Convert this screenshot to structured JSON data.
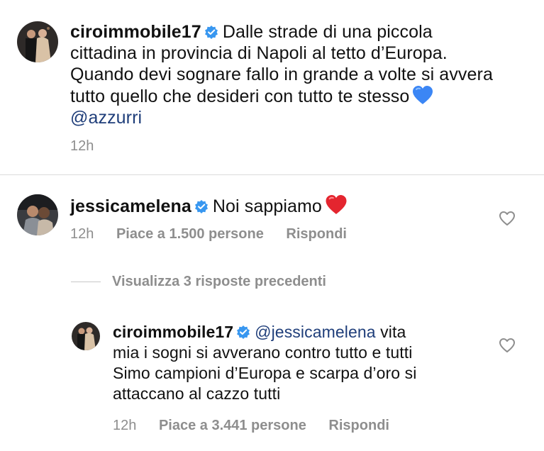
{
  "comment1": {
    "username": "ciroimmobile17",
    "lines": [
      "Dalle strade di una piccola",
      "cittadina in provincia di Napoli al tetto d’Europa.",
      "Quando devi sognare fallo in grande a volte si avvera",
      "tutto quello che desideri con tutto te stesso"
    ],
    "mention": "@azzurri",
    "time": "12h"
  },
  "comment2": {
    "username": "jessicamelena",
    "text": "Noi sappiamo",
    "time": "12h",
    "likes": "Piace a 1.500 persone",
    "reply_label": "Rispondi"
  },
  "view_replies": "Visualizza 3 risposte precedenti",
  "reply1": {
    "username": "ciroimmobile17",
    "mention": "@jessicamelena",
    "first_line_rest": "vita",
    "lines": [
      "mia i sogni si avverano contro tutto e tutti",
      "Simo campioni d’Europa e scarpa d’oro si",
      "attaccano al cazzo tutti"
    ],
    "time": "12h",
    "likes": "Piace a 3.441 persone",
    "reply_label": "Rispondi"
  },
  "colors": {
    "text": "#111111",
    "meta": "#8e8e8e",
    "mention": "#1f3e7a",
    "verified": "#3897f0",
    "blue_heart": "#3b86f5",
    "red_heart": "#e4252f"
  },
  "icons": {
    "verified": "verified-badge-icon",
    "like": "heart-outline-icon"
  }
}
